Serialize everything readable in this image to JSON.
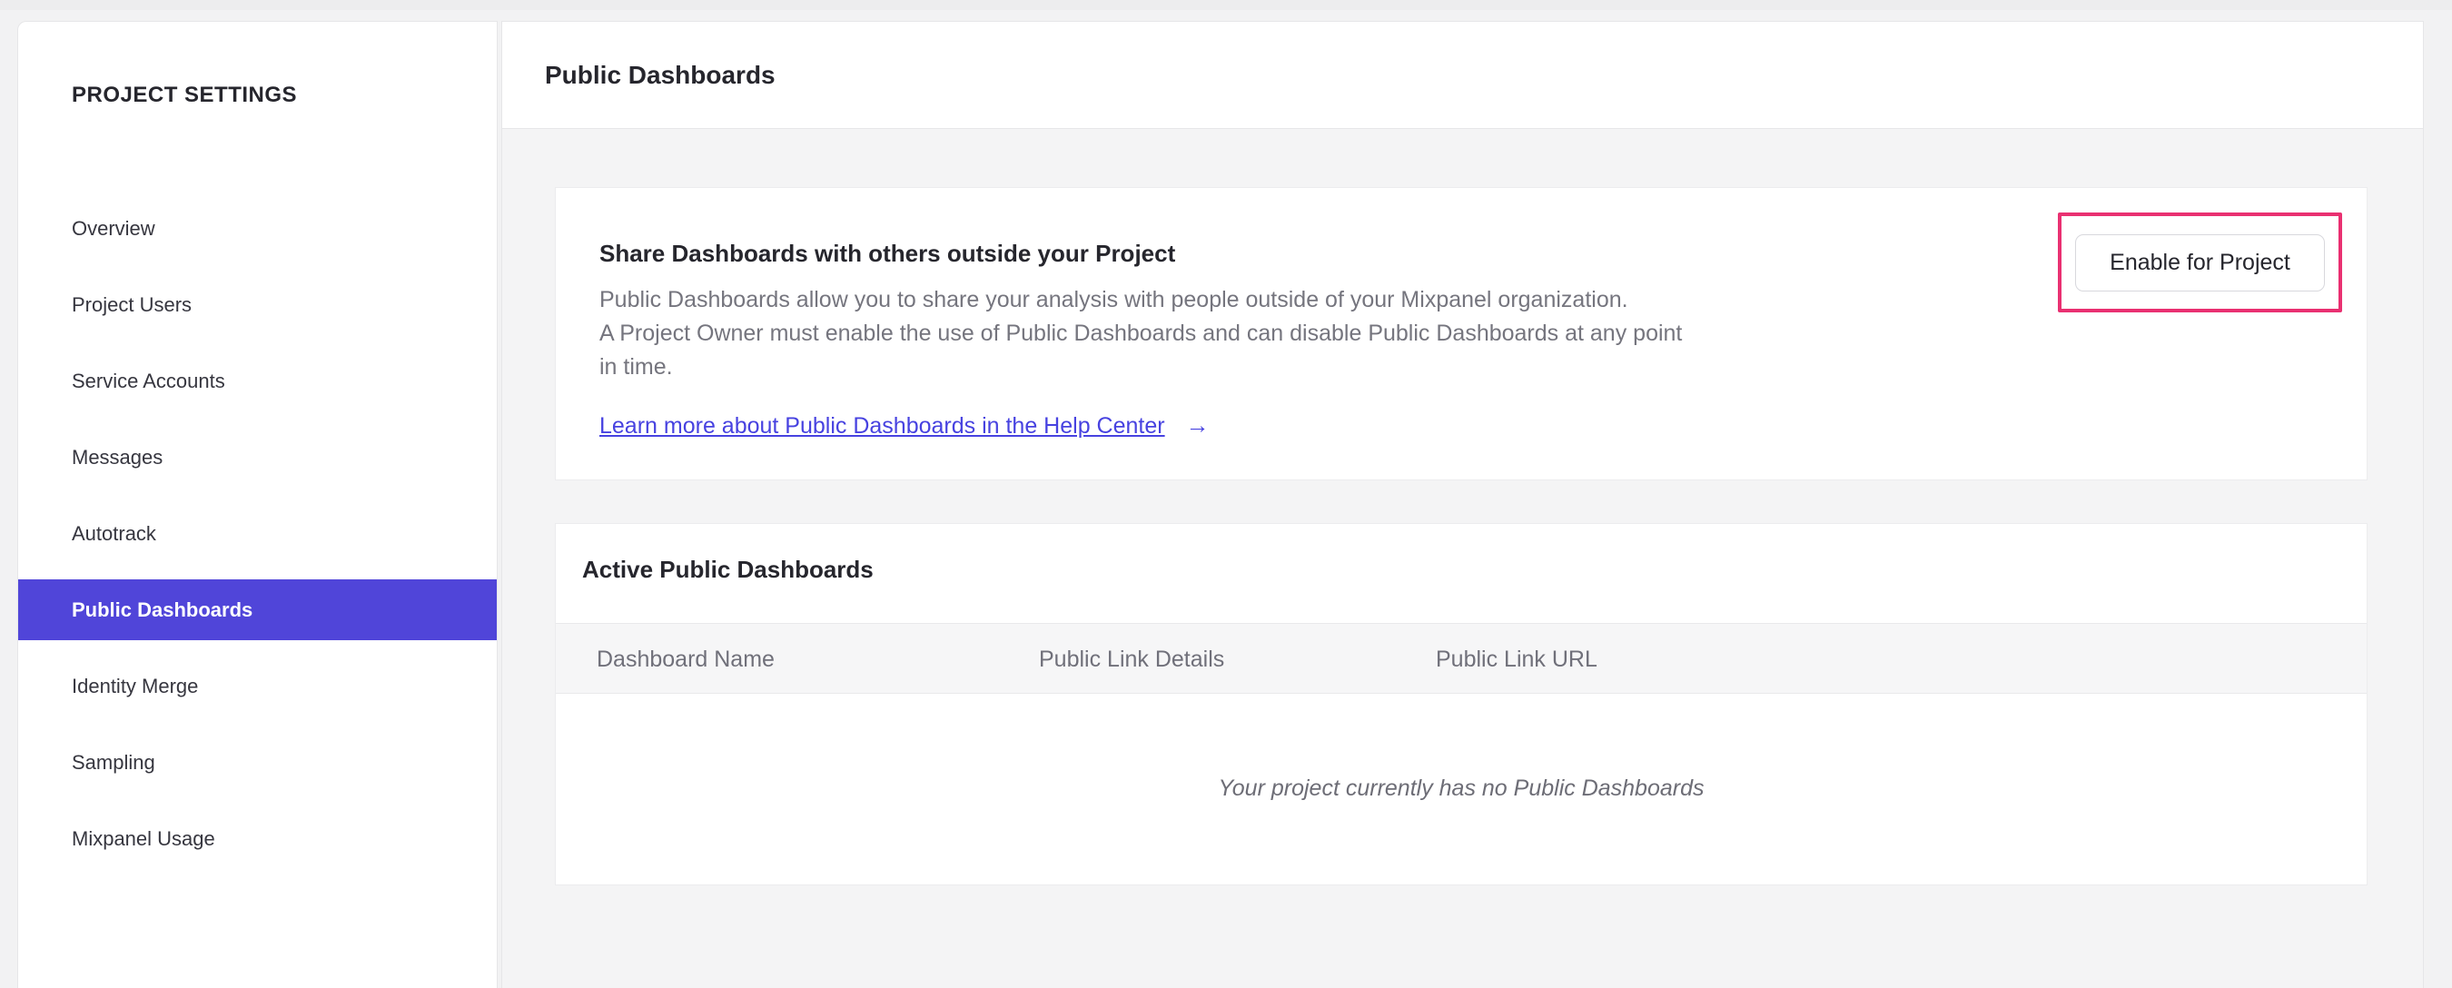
{
  "theme": {
    "accent_purple": "#5045d9",
    "link_blue": "#4742e0",
    "highlight_pink": "#e93071"
  },
  "sidebar": {
    "title": "PROJECT SETTINGS",
    "items": [
      {
        "label": "Overview",
        "selected": false
      },
      {
        "label": "Project Users",
        "selected": false
      },
      {
        "label": "Service Accounts",
        "selected": false
      },
      {
        "label": "Messages",
        "selected": false
      },
      {
        "label": "Autotrack",
        "selected": false
      },
      {
        "label": "Public Dashboards",
        "selected": true
      },
      {
        "label": "Identity Merge",
        "selected": false
      },
      {
        "label": "Sampling",
        "selected": false
      },
      {
        "label": "Mixpanel Usage",
        "selected": false
      }
    ]
  },
  "header": {
    "title": "Public Dashboards"
  },
  "share_card": {
    "heading": "Share Dashboards with others outside your Project",
    "description_lines": [
      "Public Dashboards allow you to share your analysis with people outside of your Mixpanel organization.",
      "A Project Owner must enable the use of Public Dashboards and can disable Public Dashboards at any point",
      "in time."
    ],
    "link_label": "Learn more about Public Dashboards in the Help Center",
    "link_arrow": "→",
    "enable_button_label": "Enable for Project"
  },
  "active_card": {
    "heading": "Active Public Dashboards",
    "columns": [
      "Dashboard Name",
      "Public Link Details",
      "Public Link URL"
    ],
    "empty_message": "Your project currently has no Public Dashboards"
  }
}
